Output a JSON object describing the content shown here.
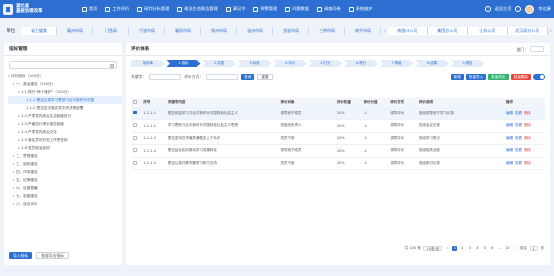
{
  "app": {
    "title_line1": "湖北省",
    "title_line2": "基层治理改革"
  },
  "nav": [
    {
      "label": "首页",
      "icon": "home-icon"
    },
    {
      "label": "工作评价",
      "icon": "chart-icon"
    },
    {
      "label": "研判分析管理",
      "icon": "analysis-icon"
    },
    {
      "label": "政治生态报告管理",
      "icon": "report-icon"
    },
    {
      "label": "事记令",
      "icon": "doc-icon"
    },
    {
      "label": "预警管理",
      "icon": "warning-icon"
    },
    {
      "label": "问题数据",
      "icon": "problem-icon"
    },
    {
      "label": "调查问卷",
      "icon": "survey-icon"
    },
    {
      "label": "系统维护",
      "icon": "settings-icon"
    }
  ],
  "header_right": {
    "return_label": "返回主页",
    "user": "李达康"
  },
  "unit": {
    "label": "单位",
    "tabs": [
      "省卫健委",
      "襄州市局",
      "门急局",
      "宁波市局",
      "襄阳市局",
      "泉州市局",
      "温州市局",
      "龙岩市局",
      "三明市局",
      "南平市局"
    ],
    "right_tabs": [
      "南昌口公司",
      "集团总公司",
      "江苏公司",
      "武汉局分公司"
    ],
    "active_index": 0
  },
  "left": {
    "title": "指标管理",
    "search_placeholder": "",
    "tree": [
      {
        "label": "评价指标（100分）",
        "indent": 0,
        "toggle": "▾"
      },
      {
        "label": "一、政治建设（100分）",
        "indent": 1,
        "toggle": "▾"
      },
      {
        "label": "1-1.践行“两个维护”（100分）",
        "indent": 2,
        "toggle": "▾"
      },
      {
        "label": "1-1-1.是否认真学习贯彻习近平新时代中国",
        "indent": 3,
        "toggle": "",
        "hl": true
      },
      {
        "label": "1-1-2.是否坚决落实党中央决策部署",
        "indent": 3,
        "toggle": ""
      },
      {
        "label": "1-2.严肃党内政治生活制度执行",
        "indent": 2,
        "toggle": "▸"
      },
      {
        "label": "1-3.严格执行请示报告制度",
        "indent": 2,
        "toggle": "▸"
      },
      {
        "label": "1-4.严肃党内政治文化",
        "indent": 2,
        "toggle": "▸"
      },
      {
        "label": "1-5.落实意识形态工作责任制",
        "indent": 2,
        "toggle": "▸"
      },
      {
        "label": "1-6.党员政治信仰",
        "indent": 2,
        "toggle": "▸"
      },
      {
        "label": "二、思想建设",
        "indent": 1,
        "toggle": "▸"
      },
      {
        "label": "三、组织建设",
        "indent": 1,
        "toggle": "▸"
      },
      {
        "label": "四、作风建设",
        "indent": 1,
        "toggle": "▸"
      },
      {
        "label": "五、纪律建设",
        "indent": 1,
        "toggle": "▸"
      },
      {
        "label": "六、反腐倡廉",
        "indent": 1,
        "toggle": "▸"
      },
      {
        "label": "七、制度建设",
        "indent": 1,
        "toggle": "▸"
      },
      {
        "label": "八、综合评价",
        "indent": 1,
        "toggle": "▸"
      }
    ],
    "import_label": "导入指标",
    "export_label": "批量导出指标"
  },
  "right": {
    "title": "评价体系",
    "dept_label": "部门：",
    "steps": [
      "指标库",
      "1.指标",
      "2.权重",
      "3.标准",
      "4.评价",
      "5.打分",
      "6.得分",
      "7.等级",
      "8.结果",
      "9.报告"
    ],
    "active_step": 1,
    "filter": {
      "keyword_label": "关键字：",
      "type_label": "评价方式：",
      "query_label": "查询",
      "reset_label": "重置"
    },
    "actions": [
      "新增",
      "批量导入",
      "批量导出",
      "批量删除"
    ],
    "columns": [
      "",
      "序号",
      "关键字内容",
      "评价对象",
      "评价权重",
      "评价分值",
      "评价方式",
      "评价说明",
      "操作"
    ],
    "rows": [
      {
        "no": "1-1-1-1",
        "content": "是否领会学习习近平新时代中国特色社会主义",
        "object": "领导班子成员",
        "weight": "20%",
        "score": "-1",
        "method": "领导评价",
        "desc": "查阅领导班子学习记录",
        "selected": true
      },
      {
        "no": "1-1-1-2",
        "content": "学习贯彻习近平新时代中国特色社会主义思想",
        "object": "党组织负责人",
        "weight": "20%",
        "score": "-1",
        "method": "领导评价",
        "desc": "查阅会议记录",
        "selected": false
      },
      {
        "no": "1-1-1-3",
        "content": "是否坚持在学懂弄通做实上下功夫",
        "object": "党员干部",
        "weight": "20%",
        "score": "-1",
        "method": "领导评价",
        "desc": "查阅学习笔记",
        "selected": false
      },
      {
        "no": "1-1-1-4",
        "content": "是否结合实际推动学习成果转化",
        "object": "领导班子成员",
        "weight": "20%",
        "score": "-1",
        "method": "领导评价",
        "desc": "查阅相关台账",
        "selected": false
      },
      {
        "no": "1-1-1-5",
        "content": "是否认真开展专题学习研讨交流",
        "object": "党员干部",
        "weight": "20%",
        "score": "-1",
        "method": "领导评价",
        "desc": "查阅研讨记录",
        "selected": false
      }
    ],
    "row_ops": [
      "编辑",
      "查看",
      "删除"
    ],
    "pager": {
      "total": "共 100 条",
      "page_size": "10条/页",
      "pages": [
        "1",
        "2",
        "3",
        "4",
        "5",
        "6",
        "...",
        "10"
      ],
      "active": "1",
      "goto_label": "前往",
      "goto_value": "1",
      "page_suffix": "页"
    }
  },
  "colors": {
    "primary": "#2c6fd1",
    "danger": "#e9473f",
    "success": "#2fb36f"
  }
}
